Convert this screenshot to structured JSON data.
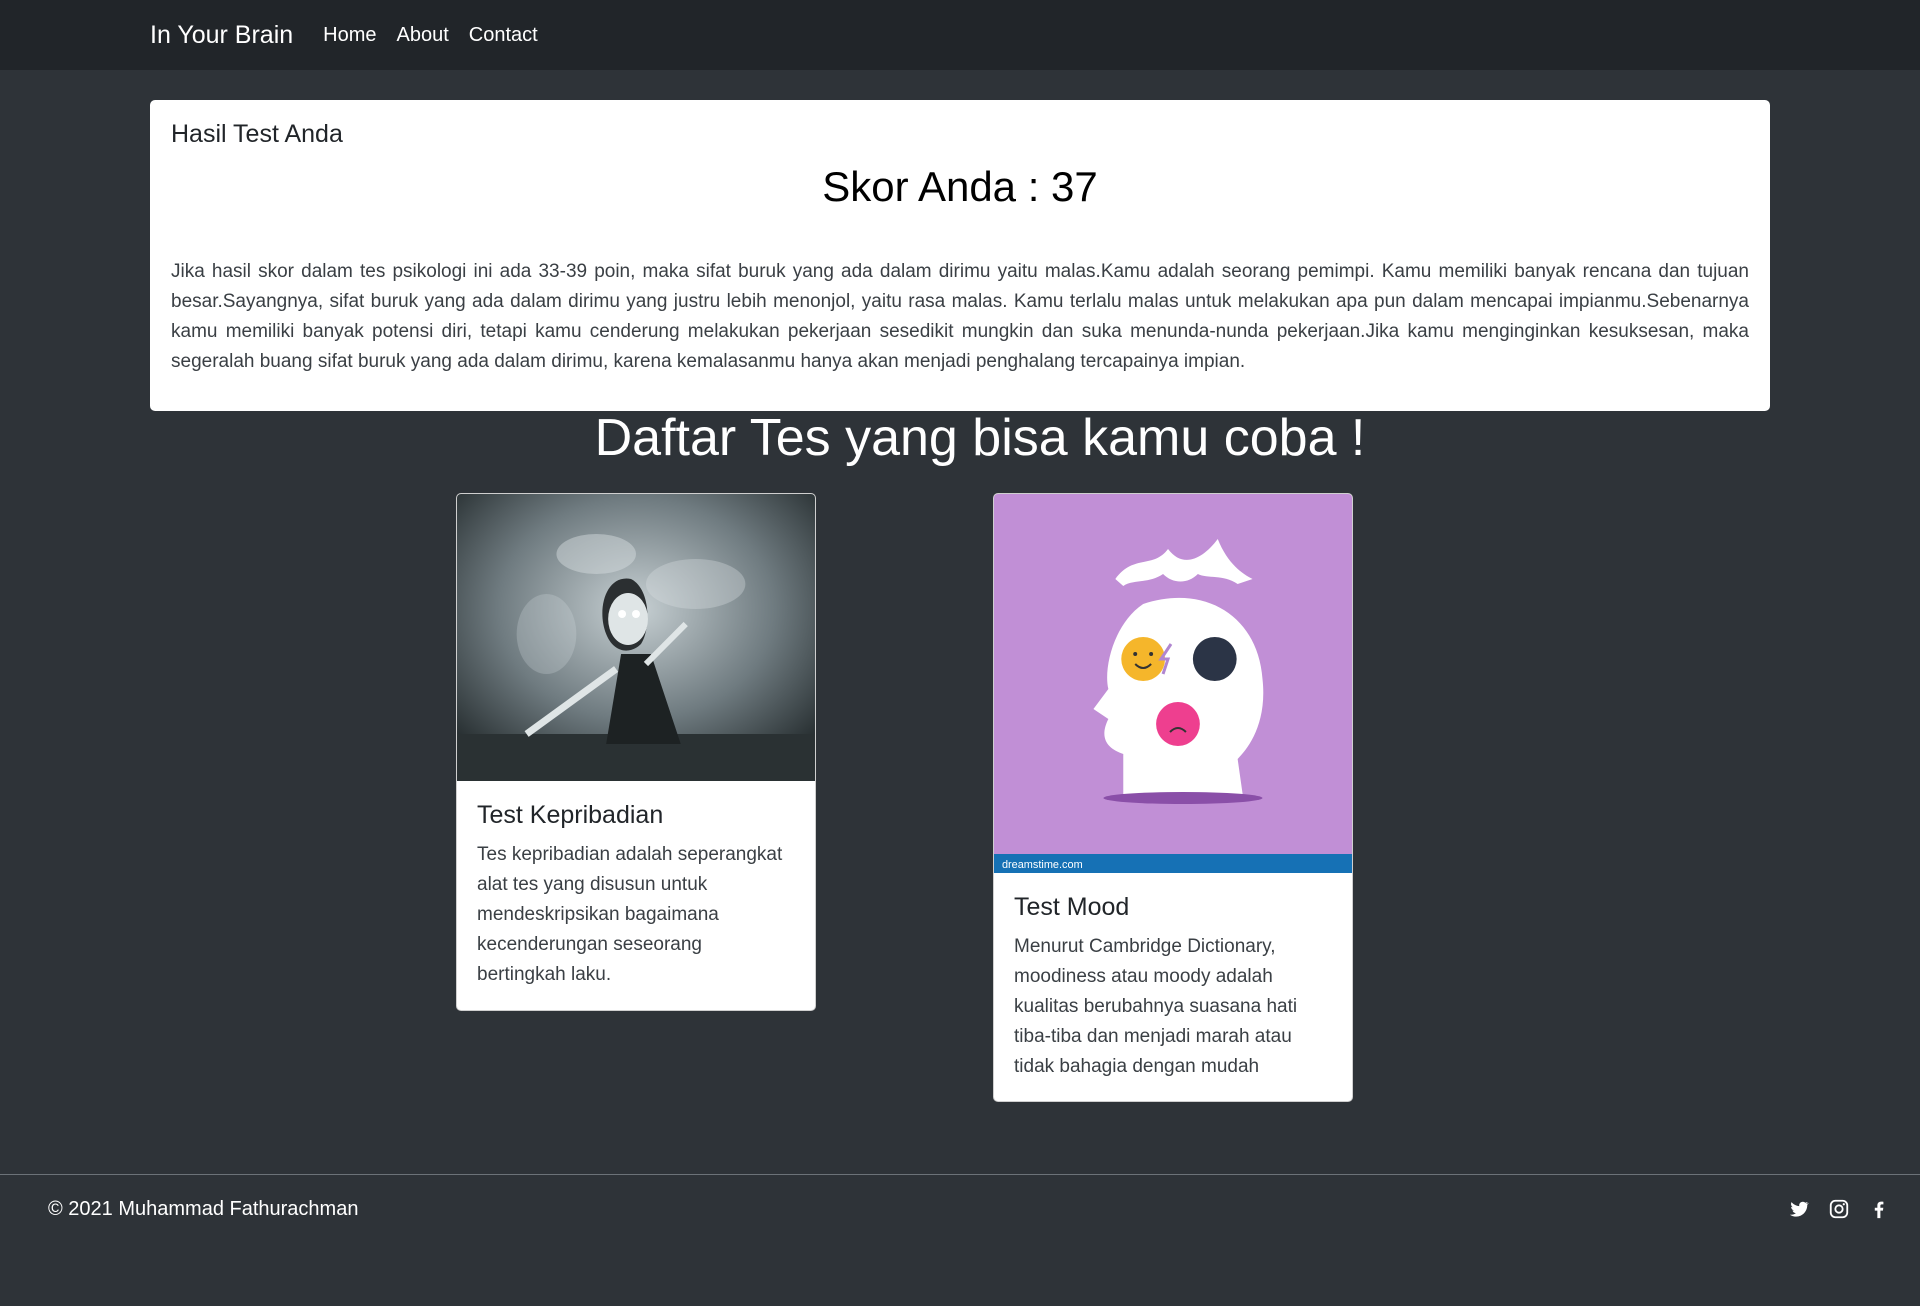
{
  "navbar": {
    "brand": "In Your Brain",
    "links": [
      "Home",
      "About",
      "Contact"
    ]
  },
  "result": {
    "header": "Hasil Test Anda",
    "score_text": "Skor Anda : 37",
    "description": "Jika hasil skor dalam tes psikologi ini ada 33-39 poin, maka sifat buruk yang ada dalam dirimu yaitu malas.Kamu adalah seorang pemimpi. Kamu memiliki banyak rencana dan tujuan besar.Sayangnya, sifat buruk yang ada dalam dirimu yang justru lebih menonjol, yaitu rasa malas. Kamu terlalu malas untuk melakukan apa pun dalam mencapai impianmu.Sebenarnya kamu memiliki banyak potensi diri, tetapi kamu cenderung melakukan pekerjaan sesedikit mungkin dan suka menunda-nunda pekerjaan.Jika kamu menginginkan kesuksesan, maka segeralah buang sifat buruk yang ada dalam dirimu, karena kemalasanmu hanya akan menjadi penghalang tercapainya impian."
  },
  "section": {
    "title": "Daftar Tes yang bisa kamu coba !"
  },
  "cards": [
    {
      "title": "Test Kepribadian",
      "text": "Tes kepribadian adalah seperangkat alat tes yang disusun untuk mendeskripsikan bagaimana kecenderungan seseorang bertingkah laku.",
      "image": "gothic-girl-illustration"
    },
    {
      "title": "Test Mood",
      "text": "Menurut Cambridge Dictionary, moodiness atau moody adalah kualitas berubahnya suasana hati tiba-tiba dan menjadi marah atau tidak bahagia dengan mudah",
      "image": "head-with-moods-illustration",
      "watermark": "dreamstime.com"
    }
  ],
  "footer": {
    "copyright": "© 2021 Muhammad Fathurachman",
    "social_icons": [
      "twitter-icon",
      "instagram-icon",
      "facebook-icon"
    ]
  },
  "colors": {
    "navbar_bg": "#212529",
    "page_bg": "#2e3338",
    "card_bg": "#ffffff",
    "mood_bg": "#c18fd6"
  }
}
